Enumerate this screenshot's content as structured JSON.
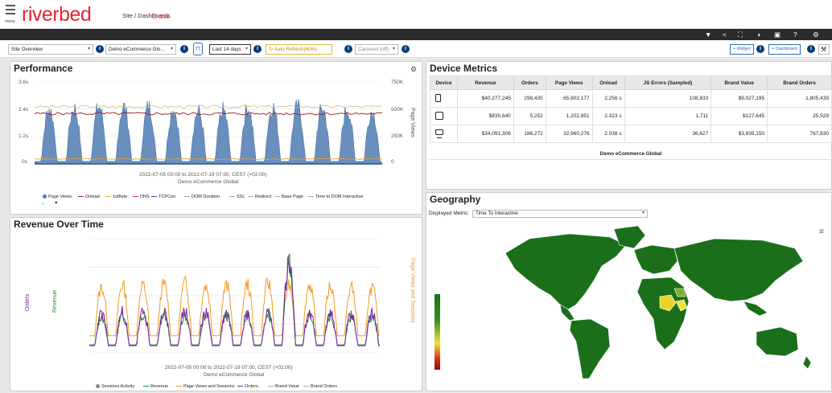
{
  "header": {
    "menu_label": "menu",
    "logo": "riverbed",
    "breadcrumb": "Site / Dashboards",
    "alert": "⓵ 203"
  },
  "controls": {
    "site": "Site Overview",
    "app": "Demo eCommerce Glo...",
    "range": "Last 14 days",
    "refresh": "Auto Refresh(60m)",
    "carousel": "Carousel (off)",
    "widget_btn": "+ Widget",
    "dashboard_btn": "+ Dashboard"
  },
  "performance": {
    "title": "Performance",
    "yleft": [
      "3.6s",
      "2.4s",
      "1.2s",
      "0s"
    ],
    "yright": [
      "750K",
      "500K",
      "250K",
      "0"
    ],
    "yright_label": "Page Views",
    "xticks": [
      "6. Jul",
      "8. Jul",
      "10. Jul",
      "12. Jul",
      "14. Jul",
      "16. Jul",
      "18. Jul"
    ],
    "caption1": "2022-07-05 00:00 to 2022-07-19 07:00, CEST (+02:00)",
    "caption2": "Demo eCommerce Global",
    "legend": [
      "Page Views",
      "Onload",
      "1stByte",
      "DNS",
      "TCPCon",
      "DOM Duration",
      "SSL",
      "Redirect",
      "Base Page",
      "Time to DOM Interactive"
    ]
  },
  "revenue": {
    "title": "Revenue Over Time",
    "yorders": [
      "8.0K",
      "6.0K",
      "4.0K",
      "2.0K",
      "0"
    ],
    "yrev": [
      "$1.0MM",
      "$750.0K",
      "$500.0K",
      "$250.0K",
      "$0"
    ],
    "yright": [
      "800K",
      "600K",
      "400K",
      "200K",
      "0"
    ],
    "label_orders": "Orders",
    "label_revenue": "Revenue",
    "label_right": "Page Views and Sessions",
    "xticks": [
      "6. Jul",
      "8. Jul",
      "10. Jul",
      "12. Jul",
      "14. Jul",
      "16. Jul",
      "18. Jul"
    ],
    "caption1": "2022-07-05 00:00 to 2022-07-19 07:00, CEST (+02:00)",
    "caption2": "Demo eCommerce Global",
    "legend": [
      "Sessions Activity",
      "Revenue",
      "Page Views and Sessions",
      "Orders",
      "Brand Value",
      "Brand Orders"
    ]
  },
  "device_metrics": {
    "title": "Device Metrics",
    "columns": [
      "Device",
      "Revenue",
      "Orders",
      "Page Views",
      "Onload",
      "JS Errors (Sampled)",
      "Brand Value",
      "Brand Orders"
    ],
    "rows": [
      {
        "device": "mobile",
        "cells": [
          "$40,277,245",
          "298,435",
          "65,802,177",
          "2.256 s",
          "108,833",
          "$9,027,195",
          "1,805,439"
        ]
      },
      {
        "device": "tablet",
        "cells": [
          "$835,640",
          "5,252",
          "1,202,851",
          "2.323 s",
          "1,711",
          "$127,645",
          "25,529"
        ]
      },
      {
        "device": "desktop",
        "cells": [
          "$34,091,306",
          "186,272",
          "32,960,276",
          "2.038 s",
          "36,627",
          "$3,839,150",
          "767,830"
        ]
      }
    ],
    "footer": "Demo eCommerce Global"
  },
  "geography": {
    "title": "Geography",
    "metric_label": "Displayed Metric:",
    "metric_value": "Time To Interactive",
    "scale": [
      "0s",
      "5s",
      "10s",
      "15s",
      "20s",
      "25s"
    ]
  },
  "colors": {
    "accent_red": "#e3262e",
    "page_views": "#4f7bb3",
    "onload": "#9b1c1c",
    "firstbyte": "#e2a33a",
    "dns": "#d63a3a",
    "tcpcon": "#7b2da6",
    "revenue": "#1e8a2a",
    "orders": "#7a1ea8",
    "sessions": "#f59a23",
    "map_green": "#1b6f1b"
  },
  "chart_data": [
    {
      "type": "area",
      "title": "Performance",
      "x": [
        "6. Jul",
        "8. Jul",
        "10. Jul",
        "12. Jul",
        "14. Jul",
        "16. Jul",
        "18. Jul"
      ],
      "ylabel": "",
      "ylim": [
        0,
        3.6
      ],
      "y2label": "Page Views",
      "y2lim": [
        0,
        750000
      ],
      "series": [
        {
          "name": "Page Views",
          "axis": "right",
          "daily_peak": [
            500000,
            510000,
            520000,
            520000,
            520000,
            500000,
            480000,
            490000,
            510000,
            520000,
            520000,
            510000,
            500000,
            480000
          ],
          "daily_trough": [
            30000,
            30000,
            30000,
            30000,
            30000,
            30000,
            30000,
            30000,
            30000,
            30000,
            30000,
            30000,
            30000,
            30000
          ]
        },
        {
          "name": "Onload",
          "axis": "left",
          "approx": 2.2
        },
        {
          "name": "1stByte",
          "axis": "left",
          "approx": 0.25
        },
        {
          "name": "DNS",
          "axis": "left",
          "approx": 0.05
        },
        {
          "name": "Base Page",
          "axis": "left",
          "approx": 2.5
        }
      ]
    },
    {
      "type": "line",
      "title": "Revenue Over Time",
      "x": [
        "6. Jul",
        "8. Jul",
        "10. Jul",
        "12. Jul",
        "14. Jul",
        "16. Jul",
        "18. Jul"
      ],
      "ylim_orders": [
        0,
        8000
      ],
      "ylim_revenue": [
        0,
        1000000
      ],
      "ylim_right": [
        0,
        800000
      ],
      "series": [
        {
          "name": "Page Views and Sessions",
          "axis": "right",
          "daily_peak": [
            460000,
            480000,
            470000,
            480000,
            490000,
            470000,
            470000,
            480000,
            490000,
            470000,
            480000,
            470000,
            460000,
            460000
          ],
          "daily_trough": [
            120000,
            120000,
            120000,
            120000,
            120000,
            120000,
            120000,
            120000,
            120000,
            120000,
            120000,
            120000,
            120000,
            120000
          ]
        },
        {
          "name": "Revenue",
          "axis": "revenue",
          "daily_peak": [
            320000,
            330000,
            330000,
            330000,
            340000,
            330000,
            330000,
            320000,
            340000,
            750000,
            330000,
            330000,
            320000,
            330000
          ],
          "daily_trough": [
            70000,
            70000,
            70000,
            70000,
            70000,
            70000,
            70000,
            70000,
            70000,
            70000,
            70000,
            70000,
            70000,
            70000
          ]
        },
        {
          "name": "Orders",
          "axis": "orders",
          "daily_peak": [
            2700,
            2800,
            2800,
            2800,
            2900,
            2800,
            2800,
            2700,
            2800,
            5900,
            2800,
            2800,
            2700,
            2800
          ],
          "daily_trough": [
            500,
            500,
            500,
            500,
            500,
            500,
            500,
            500,
            500,
            500,
            500,
            500,
            500,
            500
          ]
        }
      ]
    }
  ]
}
